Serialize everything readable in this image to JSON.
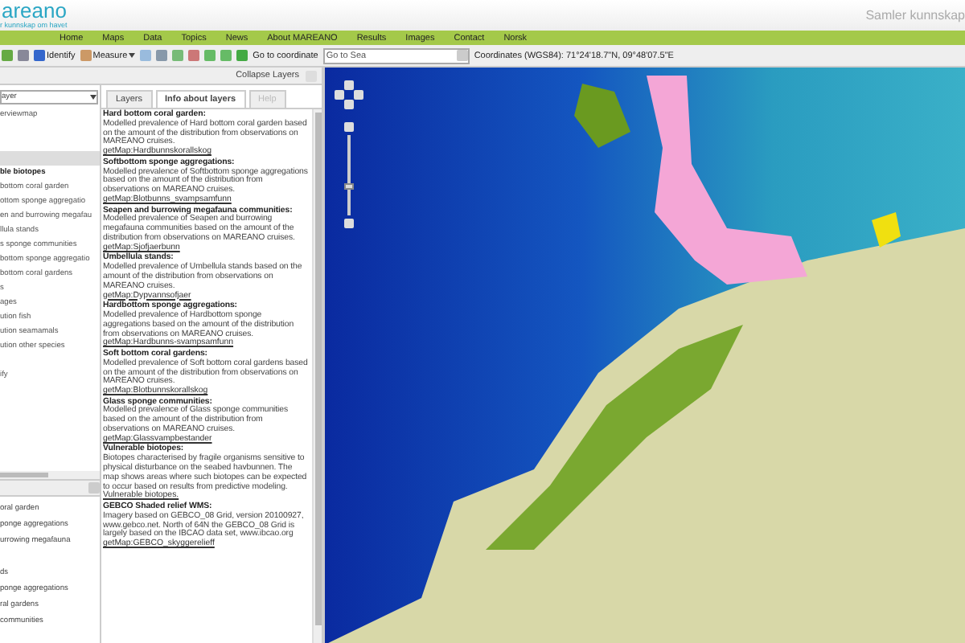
{
  "header": {
    "logo": "areano",
    "tagline": "r kunnskap om havet",
    "slogan": "Samler kunnskap"
  },
  "nav": [
    "Home",
    "Maps",
    "Data",
    "Topics",
    "News",
    "About MAREANO",
    "Results",
    "Images",
    "Contact",
    "Norsk"
  ],
  "toolbar": {
    "identify": "Identify",
    "measure": "Measure",
    "goto_label": "Go to coordinate",
    "goto_value": "Go to Sea",
    "coordinates": "Coordinates (WGS84): 71°24'18.7\"N, 09°48'07.5\"E"
  },
  "layers_panel": {
    "collapse": "Collapse Layers",
    "dropdown": "ayer",
    "tree": [
      {
        "text": "erviewmap",
        "kind": "item",
        "selected": false
      },
      {
        "kind": "gap",
        "selected": false
      },
      {
        "kind": "gap",
        "selected": false
      },
      {
        "kind": "gap",
        "selected": true
      },
      {
        "text": "ble biotopes",
        "kind": "group",
        "selected": false
      },
      {
        "text": " bottom coral garden",
        "kind": "item",
        "selected": false
      },
      {
        "text": "ottom sponge aggregatio",
        "kind": "item",
        "selected": false
      },
      {
        "text": "en and burrowing megafau",
        "kind": "item",
        "selected": false
      },
      {
        "text": "llula stands",
        "kind": "item",
        "selected": false
      },
      {
        "text": "s sponge communities",
        "kind": "item",
        "selected": false
      },
      {
        "text": "bottom sponge aggregatio",
        "kind": "item",
        "selected": false
      },
      {
        "text": "bottom coral gardens",
        "kind": "item",
        "selected": false
      },
      {
        "text": "s",
        "kind": "item",
        "selected": false
      },
      {
        "text": "ages",
        "kind": "item",
        "selected": false
      },
      {
        "text": "ution fish",
        "kind": "item",
        "selected": false
      },
      {
        "text": "ution seamamals",
        "kind": "item",
        "selected": false
      },
      {
        "text": "ution other species",
        "kind": "item",
        "selected": false
      },
      {
        "kind": "gap",
        "selected": false
      },
      {
        "text": "ify",
        "kind": "item",
        "selected": false
      },
      {
        "kind": "gap",
        "selected": false
      }
    ],
    "legend": [
      {
        "kind": "item",
        "text": "oral garden"
      },
      {
        "kind": "item",
        "text": "ponge aggregations"
      },
      {
        "kind": "item",
        "text": "urrowing megafauna"
      },
      {
        "kind": "gap"
      },
      {
        "kind": "item",
        "text": "ds"
      },
      {
        "kind": "item",
        "text": "ponge aggregations"
      },
      {
        "kind": "item",
        "text": "ral gardens"
      },
      {
        "kind": "item",
        "text": "communities"
      }
    ]
  },
  "tabs": [
    {
      "label": "Layers",
      "selected": false,
      "disabled": false
    },
    {
      "label": "Info about layers",
      "selected": true,
      "disabled": false
    },
    {
      "label": "Help",
      "selected": false,
      "disabled": true
    }
  ],
  "info": [
    {
      "title": "Hard bottom coral garden:",
      "text": "Modelled prevalence of Hard bottom coral garden based on the amount of the distribution from observations on MAREANO cruises.",
      "link": "getMap:Hardbunnskorallskog"
    },
    {
      "title": "Softbottom sponge aggregations:",
      "text": "Modelled prevalence of Softbottom sponge aggregations based on the amount of the distribution from observations on MAREANO cruises.",
      "link": "getMap:Blotbunns_svampsamfunn"
    },
    {
      "title": "Seapen and burrowing megafauna communities:",
      "text": "Modelled prevalence of Seapen and burrowing megafauna communities based on the amount of the distribution from observations on MAREANO cruises.",
      "link": "getMap:Sjofjaerbunn"
    },
    {
      "title": "Umbellula stands:",
      "text": "Modelled prevalence of Umbellula stands based on the amount of the distribution from observations on MAREANO cruises.",
      "link": "getMap:Dypvannsofjaer"
    },
    {
      "title": "Hardbottom sponge aggregations:",
      "text": "Modelled prevalence of Hardbottom sponge aggregations based on the amount of the distribution from observations on MAREANO cruises.",
      "link": "getMap:Hardbunns-svampsamfunn"
    },
    {
      "title": "Soft bottom coral gardens:",
      "text": "Modelled prevalence of Soft bottom coral gardens based on the amount of the distribution from observations on MAREANO cruises.",
      "link": "getMap:Blotbunnskorallskog"
    },
    {
      "title": "Glass sponge communities:",
      "text": "Modelled prevalence of Glass sponge communities based on the amount of the distribution from observations on MAREANO cruises.",
      "link": "getMap:Glassvampbestander"
    },
    {
      "title": "Vulnerable biotopes:",
      "text": "Biotopes characterised by fragile organisms sensitive to physical disturbance on the seabed havbunnen. The map shows areas where such biotopes can be expected to occur based on results from predictive modeling.",
      "link": "Vulnerable biotopes."
    },
    {
      "title": "GEBCO Shaded relief WMS:",
      "text": "Imagery based on GEBCO_08 Grid, version 20100927, www.gebco.net. North of 64N the GEBCO_08 Grid is largely based on the IBCAO data set, www.ibcao.org",
      "link": "getMap:GEBCO_skyggerelieff"
    }
  ],
  "map": {
    "zoom_slider": {
      "level": 0.36
    }
  }
}
